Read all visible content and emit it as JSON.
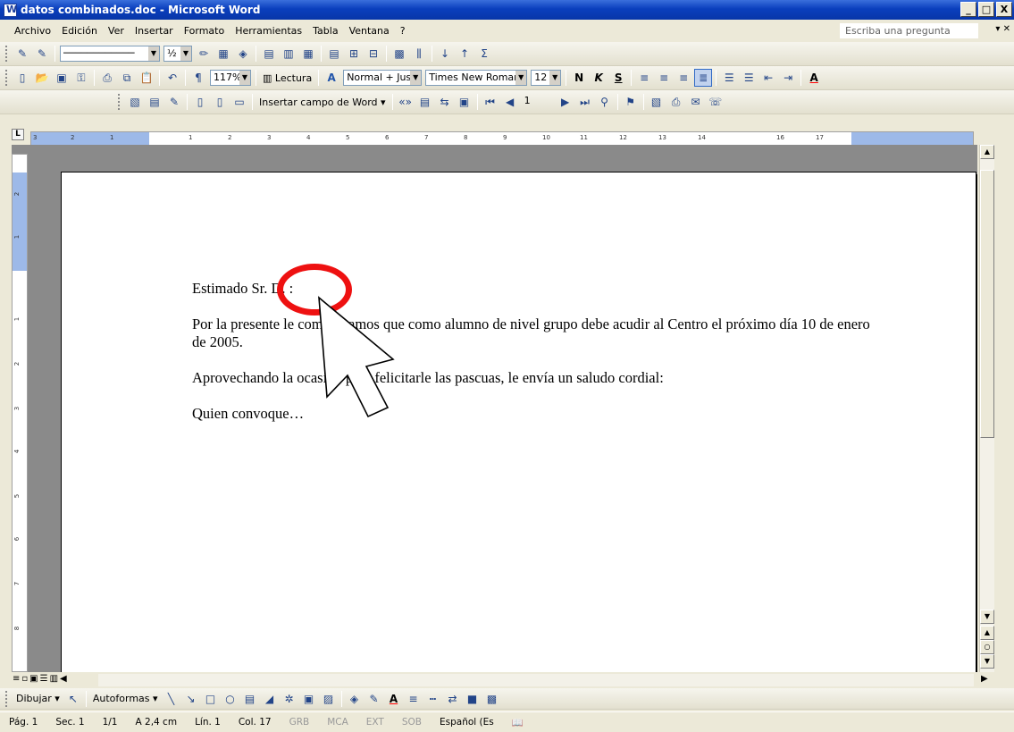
{
  "window": {
    "title": "datos combinados.doc - Microsoft Word",
    "buttons": [
      "_",
      "□",
      "X"
    ]
  },
  "menu": {
    "items": [
      "Archivo",
      "Edición",
      "Ver",
      "Insertar",
      "Formato",
      "Herramientas",
      "Tabla",
      "Ventana",
      "?"
    ],
    "ask_placeholder": "Escriba una pregunta"
  },
  "toolbar1": {
    "line_width": "½"
  },
  "toolbar2": {
    "zoom": "117%",
    "read_label": "Lectura",
    "style": "Normal + Justifi",
    "font": "Times New Roman",
    "size": "12",
    "bold": "N",
    "italic": "K",
    "underline": "S",
    "font_color": "A"
  },
  "toolbar3": {
    "insert_field": "Insertar campo de Word",
    "record": "1"
  },
  "ruler": {
    "ticks": [
      "3",
      "2",
      "1",
      "1",
      "2",
      "3",
      "4",
      "5",
      "6",
      "7",
      "8",
      "9",
      "10",
      "11",
      "12",
      "13",
      "14",
      "16",
      "17"
    ],
    "vticks": [
      "2",
      "1",
      "1",
      "2",
      "3",
      "4",
      "5",
      "6",
      "7",
      "8"
    ]
  },
  "document": {
    "line1": "Estimado Sr. D.  :",
    "para2": "Por la presente le comunicamos que como alumno de nivel  grupo debe acudir al Centro el próximo día 10 de enero de 2005.",
    "para3": "Aprovechando la ocasión para felicitarle las pascuas, le envía un saludo cordial:",
    "para4": "Quien convoque…"
  },
  "drawbar": {
    "draw": "Dibujar",
    "autoshapes": "Autoformas"
  },
  "status": {
    "page": "Pág. 1",
    "section": "Sec. 1",
    "pages": "1/1",
    "at": "A 2,4 cm",
    "line": "Lín. 1",
    "col": "Col. 17",
    "grb": "GRB",
    "mca": "MCA",
    "ext": "EXT",
    "sob": "SOB",
    "lang": "Español (Es"
  },
  "colors": {
    "titlebar": "#0a3fbd",
    "annotation": "#e11111",
    "ruler_margin": "#9db9e8"
  }
}
